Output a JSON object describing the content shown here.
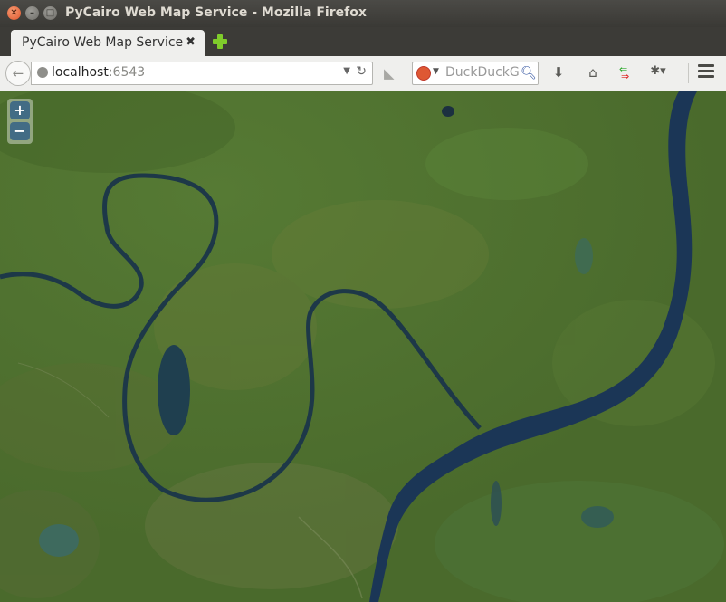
{
  "window": {
    "title": "PyCairo Web Map Service - Mozilla Firefox"
  },
  "tab": {
    "title": "PyCairo Web Map Service",
    "close": "✖"
  },
  "address": {
    "host": "localhost",
    "port": ":6543"
  },
  "search": {
    "placeholder": "DuckDuckGo"
  },
  "map": {
    "zoom_in": "+",
    "zoom_out": "−"
  },
  "icons": [
    "close-icon",
    "minimize-icon",
    "maximize-icon",
    "new-tab-icon",
    "back-icon",
    "globe-icon",
    "dropdown-icon",
    "reload-icon",
    "rss-icon",
    "duckduckgo-icon",
    "search-icon",
    "download-icon",
    "home-icon",
    "sync-icon",
    "addon-icon",
    "menu-icon"
  ]
}
